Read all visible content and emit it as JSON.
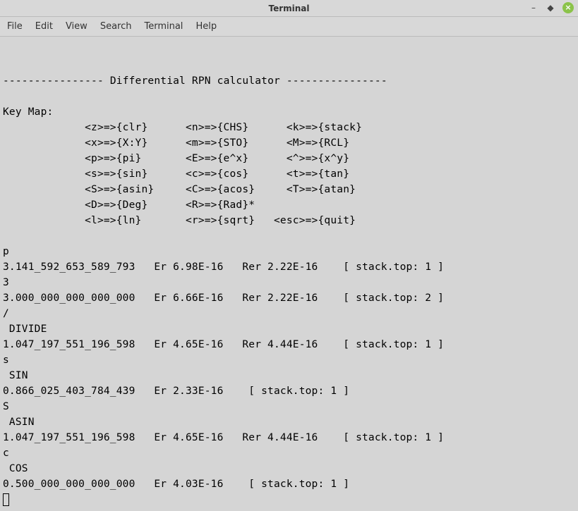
{
  "window": {
    "title": "Terminal"
  },
  "menu": {
    "file": "File",
    "edit": "Edit",
    "view": "View",
    "search": "Search",
    "terminal": "Terminal",
    "help": "Help"
  },
  "content": {
    "header_rule": "----------------",
    "header_title": "Differential RPN calculator",
    "keymap_label": "Key Map:",
    "keymap_lines": [
      "             <z>=>{clr}      <n>=>{CHS}      <k>=>{stack}",
      "             <x>=>{X:Y}      <m>=>{STO}      <M>=>{RCL}",
      "             <p>=>{pi}       <E>=>{e^x}      <^>=>{x^y}",
      "             <s>=>{sin}      <c>=>{cos}      <t>=>{tan}",
      "             <S>=>{asin}     <C>=>{acos}     <T>=>{atan}",
      "             <D>=>{Deg}      <R>=>{Rad}*",
      "             <l>=>{ln}       <r>=>{sqrt}   <esc>=>{quit}"
    ],
    "session_lines": [
      "p",
      "3.141_592_653_589_793   Er 6.98E-16   Rer 2.22E-16    [ stack.top: 1 ]",
      "3",
      "3.000_000_000_000_000   Er 6.66E-16   Rer 2.22E-16    [ stack.top: 2 ]",
      "/",
      " DIVIDE",
      "1.047_197_551_196_598   Er 4.65E-16   Rer 4.44E-16    [ stack.top: 1 ]",
      "s",
      " SIN",
      "0.866_025_403_784_439   Er 2.33E-16    [ stack.top: 1 ]",
      "S",
      " ASIN",
      "1.047_197_551_196_598   Er 4.65E-16   Rer 4.44E-16    [ stack.top: 1 ]",
      "c",
      " COS",
      "0.500_000_000_000_000   Er 4.03E-16    [ stack.top: 1 ]"
    ]
  }
}
